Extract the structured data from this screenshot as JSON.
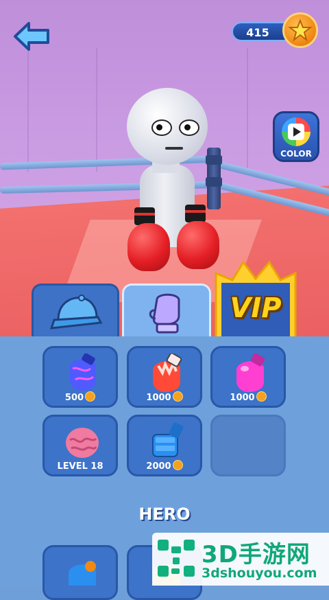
{
  "header": {
    "back_icon": "back-arrow-icon",
    "coins": "415",
    "coin_icon": "star-coin-icon",
    "color_button": {
      "label": "COLOR",
      "icon": "color-palette-play-icon"
    }
  },
  "tabs": [
    {
      "id": "hats",
      "icon": "cap-icon",
      "selected": false
    },
    {
      "id": "gloves",
      "icon": "glove-icon",
      "selected": true
    },
    {
      "id": "vip",
      "label": "VIP",
      "selected": false
    }
  ],
  "items": [
    {
      "id": "glove-galaxy",
      "price": "500",
      "currency_icon": "coin-icon",
      "color": "#5a6cff"
    },
    {
      "id": "glove-flame",
      "price": "1000",
      "currency_icon": "coin-icon",
      "color": "#ff4d3a"
    },
    {
      "id": "glove-pink",
      "price": "1000",
      "currency_icon": "coin-icon",
      "color": "#ff3fd2"
    },
    {
      "id": "glove-brain",
      "label": "LEVEL 18",
      "color": "#f07aa0"
    },
    {
      "id": "glove-robot",
      "price": "2000",
      "currency_icon": "coin-icon",
      "color": "#2b8ff0"
    },
    {
      "id": "empty-slot"
    }
  ],
  "section": {
    "title": "HERO"
  },
  "watermark": {
    "title": "3D手游网",
    "url": "3dshouyou.com"
  },
  "colors": {
    "panel": "#6ea1dc",
    "tab_active": "#7fb3ef",
    "tile": "#3d73c9",
    "coin": "#f3a21f",
    "vip": "#ffd21c"
  }
}
